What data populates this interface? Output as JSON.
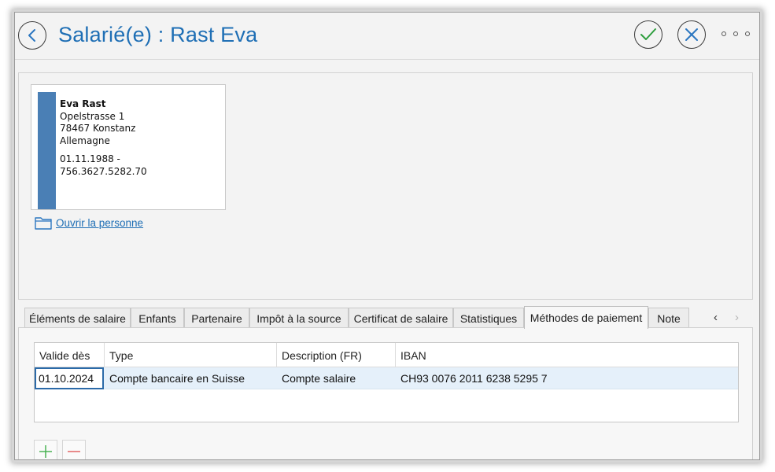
{
  "header": {
    "title": "Salarié(e) : Rast Eva",
    "back_icon": "chevron-left-icon",
    "confirm_icon": "check-icon",
    "cancel_icon": "close-icon",
    "more_icon": "more-horizontal-icon"
  },
  "person_card": {
    "name": "Eva Rast",
    "street": "Opelstrasse 1",
    "city": "78467 Konstanz",
    "country": "Allemagne",
    "dob_line": "01.11.1988 -",
    "ssn": "756.3627.5282.70",
    "accent_color": "#4a7fb5"
  },
  "open_person_link": "Ouvrir la personne",
  "tabs": [
    {
      "label": "Éléments de salaire"
    },
    {
      "label": "Enfants"
    },
    {
      "label": "Partenaire"
    },
    {
      "label": "Impôt à la source"
    },
    {
      "label": "Certificat de salaire"
    },
    {
      "label": "Statistiques"
    },
    {
      "label": "Méthodes de paiement",
      "active": true
    },
    {
      "label": "Note"
    }
  ],
  "tab_nav": {
    "prev": "‹",
    "next": "›"
  },
  "payment_table": {
    "columns": [
      "Valide dès",
      "Type",
      "Description (FR)",
      "IBAN"
    ],
    "rows": [
      [
        "01.10.2024",
        "Compte bancaire en Suisse",
        "Compte salaire",
        "CH93 0076 2011 6238 5295 7"
      ]
    ]
  },
  "actions": {
    "add_icon": "plus-icon",
    "remove_icon": "minus-icon"
  },
  "colors": {
    "title": "#1f6fb5",
    "confirm": "#2e9e3e",
    "cancel": "#2b76c0",
    "selected_row": "#e5f0fa"
  }
}
